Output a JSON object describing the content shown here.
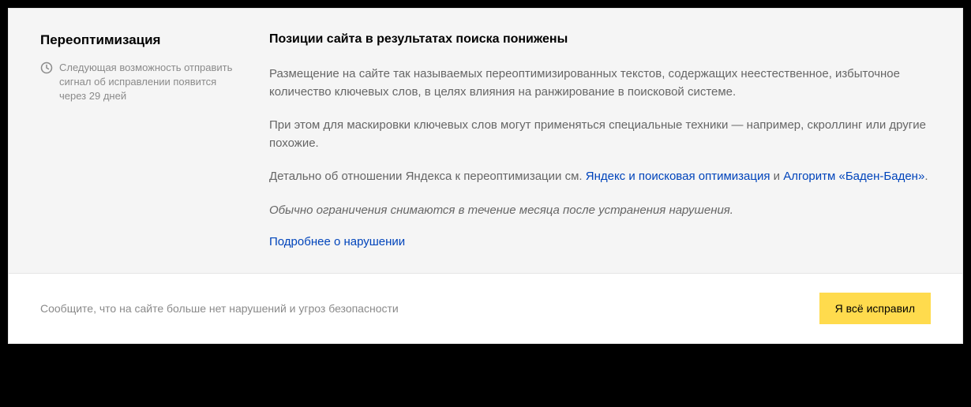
{
  "sidebar": {
    "title": "Переоптимизация",
    "status_text": "Следующая возможность отправить сигнал об исправлении появится через 29 дней"
  },
  "content": {
    "subtitle": "Позиции сайта в результатах поиска понижены",
    "paragraph1": "Размещение на сайте так называемых переоптимизированных текстов, содержащих неестественное, избыточное количество ключевых слов, в целях влияния на ранжирование в поисковой системе.",
    "paragraph2": "При этом для маскировки ключевых слов могут применяться специальные техники — например, скроллинг или другие похожие.",
    "paragraph3_prefix": "Детально об отношении Яндекса к переоптимизации см. ",
    "link1_text": "Яндекс и поисковая оптимизация",
    "paragraph3_middle": " и ",
    "link2_text": "Алгоритм «Баден-Баден»",
    "paragraph3_suffix": ".",
    "italic_note": "Обычно ограничения снимаются в течение месяца после устранения нарушения.",
    "details_link": "Подробнее о нарушении"
  },
  "footer": {
    "hint_text": "Сообщите, что на сайте больше нет нарушений и угроз безопасности",
    "button_label": "Я всё исправил"
  },
  "colors": {
    "link_color": "#04b",
    "button_bg": "#ffdb4d"
  }
}
